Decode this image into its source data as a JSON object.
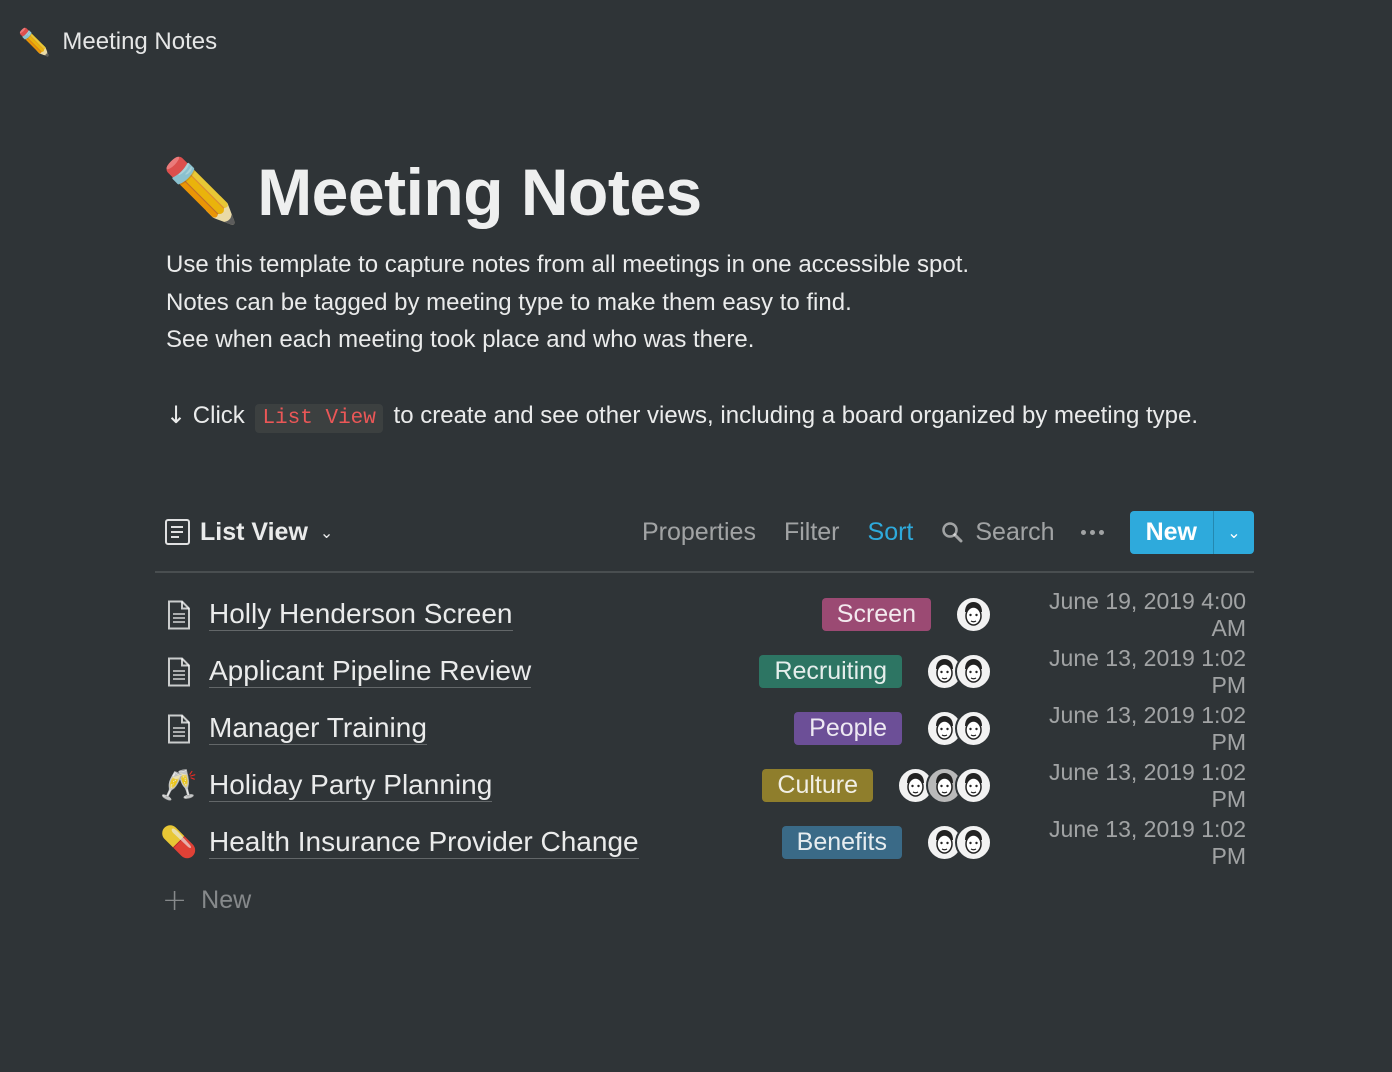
{
  "breadcrumb": {
    "emoji": "✏️",
    "title": "Meeting Notes"
  },
  "page": {
    "emoji": "✏️",
    "title": "Meeting Notes",
    "description": [
      "Use this template to capture notes from all meetings in one accessible spot.",
      "Notes can be tagged by meeting type to make them easy to find.",
      "See when each meeting took place and who was there."
    ],
    "hint": {
      "arrow": "↓",
      "before": "Click",
      "code": "List View",
      "after": "to create and see other views, including a board organized by meeting type."
    }
  },
  "toolbar": {
    "view_label": "List View",
    "properties": "Properties",
    "filter": "Filter",
    "sort": "Sort",
    "search": "Search",
    "new": "New"
  },
  "rows": [
    {
      "icon": "document-icon",
      "title": "Holly Henderson Screen",
      "tag": "Screen",
      "tag_color": "#9b4a73",
      "attendees": 1,
      "date": "June 19, 2019 4:00 AM"
    },
    {
      "icon": "document-icon",
      "title": "Applicant Pipeline Review",
      "tag": "Recruiting",
      "tag_color": "#2d7563",
      "attendees": 2,
      "date": "June 13, 2019 1:02 PM"
    },
    {
      "icon": "document-icon",
      "title": "Manager Training",
      "tag": "People",
      "tag_color": "#6c4f97",
      "attendees": 2,
      "date": "June 13, 2019 1:02 PM"
    },
    {
      "icon": "champagne-icon",
      "emoji": "🥂",
      "title": "Holiday Party Planning",
      "tag": "Culture",
      "tag_color": "#8f7e2c",
      "attendees": 3,
      "date": "June 13, 2019 1:02 PM"
    },
    {
      "icon": "pill-icon",
      "emoji": "💊",
      "title": "Health Insurance Provider Change",
      "tag": "Benefits",
      "tag_color": "#3a6a87",
      "attendees": 2,
      "date": "June 13, 2019 1:02 PM"
    }
  ],
  "add_new": "New",
  "colors": {
    "accent": "#2eaadc",
    "background": "#2f3437",
    "code_text": "#eb5757"
  }
}
